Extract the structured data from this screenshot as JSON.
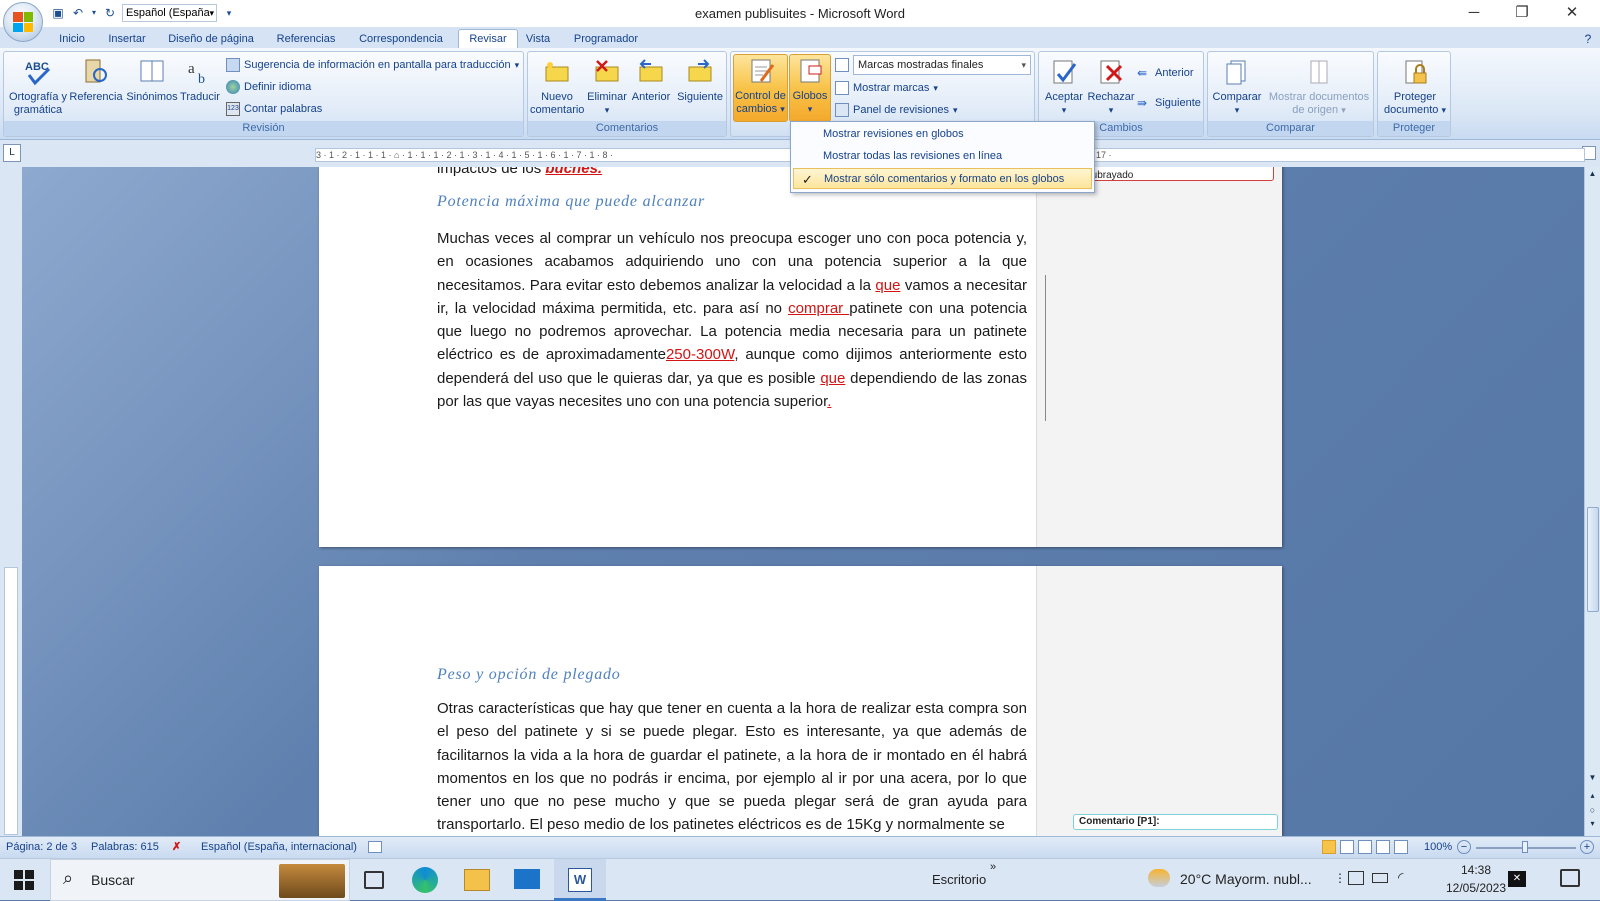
{
  "window": {
    "title": "examen publisuites - Microsoft Word"
  },
  "qat": {
    "language": "Español (España"
  },
  "tabs": [
    "Inicio",
    "Insertar",
    "Diseño de página",
    "Referencias",
    "Correspondencia",
    "Revisar",
    "Vista",
    "Programador"
  ],
  "ribbon": {
    "revision": {
      "label": "Revisión",
      "spelling": "Ortografía y gramática",
      "research": "Referencia",
      "synonyms": "Sinónimos",
      "translate": "Traducir",
      "translate_tip": "Sugerencia de información en pantalla para traducción",
      "set_language": "Definir idioma",
      "word_count": "Contar palabras"
    },
    "comments": {
      "label": "Comentarios",
      "new": "Nuevo comentario",
      "delete": "Eliminar",
      "previous": "Anterior",
      "next": "Siguiente"
    },
    "tracking": {
      "track_changes": "Control de cambios",
      "balloons": "Globos",
      "markup_select": "Marcas mostradas finales",
      "show_markup": "Mostrar marcas",
      "review_pane": "Panel de revisiones"
    },
    "changes": {
      "label": "Cambios",
      "accept": "Aceptar",
      "reject": "Rechazar",
      "previous": "Anterior",
      "next": "Siguiente"
    },
    "compare": {
      "label": "Comparar",
      "compare": "Comparar",
      "show_source": "Mostrar documentos de origen"
    },
    "protect": {
      "label": "Proteger",
      "protect_doc": "Proteger documento"
    }
  },
  "balloons_menu": [
    {
      "label": "Mostrar revisiones en globos",
      "checked": false
    },
    {
      "label": "Mostrar todas las revisiones en línea",
      "checked": false
    },
    {
      "label": "Mostrar sólo comentarios y formato en los globos",
      "checked": true
    }
  ],
  "ruler": "3 · 1 · 2 · 1 · 1 · 1 · ⌂ · 1 · 1 · 1 · 2 · 1 · 3 · 1 · 4 · 1 · 5 · 1 · 6 · 1 · 7 · 1 · 8 ·",
  "ruler_end": "17 ·",
  "page1": {
    "top_text_prefix": "impactos de los ",
    "top_text_rev": "buches.",
    "heading": "Potencia máxima que puede alcanzar",
    "p1": "Muchas veces al comprar un vehículo nos preocupa escoger uno con poca potencia y, en ocasiones acabamos adquiriendo uno con una potencia superior a la que necesitamos. Para evitar esto debemos analizar la velocidad a la ",
    "r1": "que",
    "p2": " vamos a necesitar ir, la velocidad máxima permitida, etc. para así no ",
    "r2": "comprar ",
    "p3": "patinete con una potencia que luego no podremos aprovechar. La potencia media necesaria para un patinete eléctrico es de aproximadamente",
    "r3": "250-300W",
    "p4": ", aunque como dijimos anteriormente esto dependerá del uso que le quieras dar, ya que es posible ",
    "r4": "que",
    "p5": " dependiendo de las zonas por las que vayas necesites uno con una potencia superior",
    "r5": ".",
    "comment": "Con formato: Fuente: Negrita, Subrayado"
  },
  "page2": {
    "heading": "Peso y opción de plegado",
    "p1": "Otras características que hay que tener en cuenta a la hora de realizar esta compra son el peso del patinete y si se puede plegar. Esto es interesante, ya que además de facilitarnos la vida a la hora de guardar el patinete, a la hora de ir montado en él  habrá momentos en los que no podrás ir encima, por ejemplo al ir por una acera, por lo que tener uno que no pese mucho y que se pueda plegar será de gran ayuda para transportarlo. El peso medio de los patinetes eléctricos es de 15Kg y normalmente se",
    "comment": "Comentario [P1]:"
  },
  "status": {
    "page": "Página: 2 de 3",
    "words": "Palabras: 615",
    "language": "Español (España, internacional)",
    "zoom": "100%"
  },
  "taskbar": {
    "search": "Buscar",
    "desktop": "Escritorio",
    "weather": "20°C  Mayorm. nubl...",
    "time": "14:38",
    "date": "12/05/2023"
  },
  "colors": {
    "accent": "#15428b",
    "revision": "#d21414",
    "heading": "#4f81bd",
    "highlight": "#f8c349"
  }
}
